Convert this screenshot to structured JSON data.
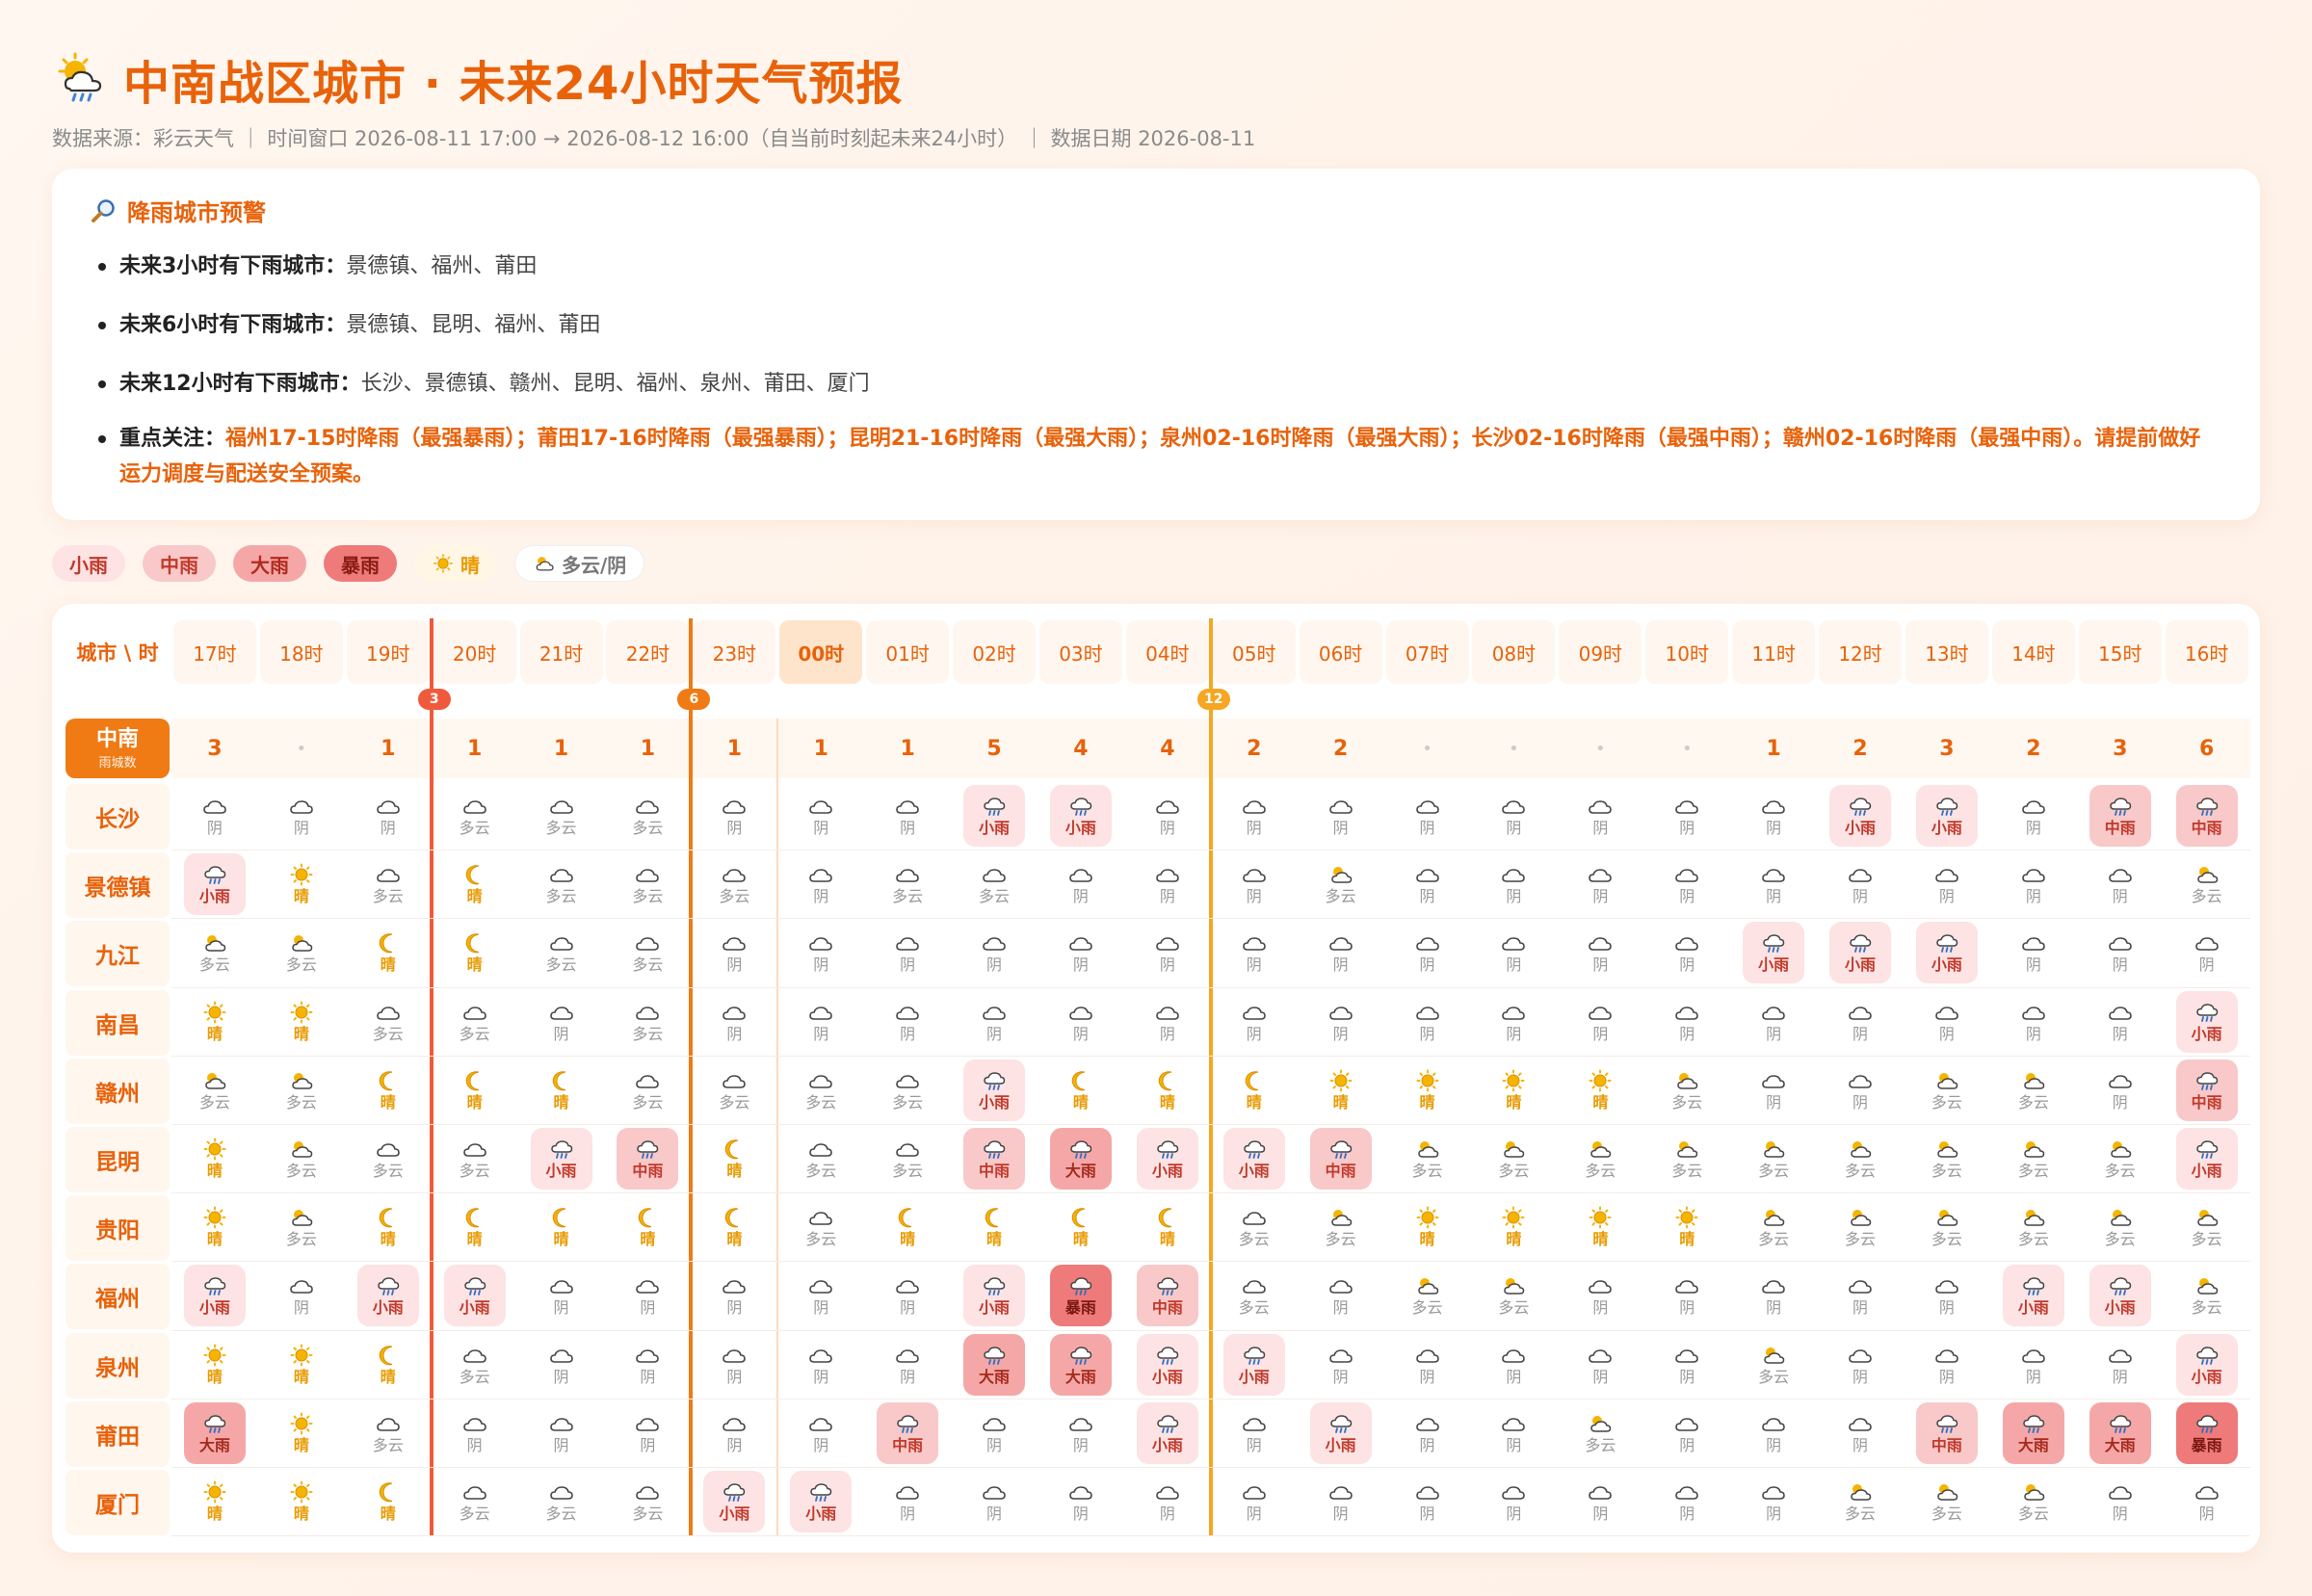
{
  "header": {
    "title": "中南战区城市 · 未来24小时天气预报",
    "subtitle": "数据来源：彩云天气 ｜ 时间窗口 2026-08-11 17:00 → 2026-08-12 16:00（自当前时刻起未来24小时） ｜ 数据日期 2026-08-11"
  },
  "alert": {
    "title": "降雨城市预警",
    "items": [
      {
        "label": "未来3小时有下雨城市：",
        "text": "景德镇、福州、莆田"
      },
      {
        "label": "未来6小时有下雨城市：",
        "text": "景德镇、昆明、福州、莆田"
      },
      {
        "label": "未来12小时有下雨城市：",
        "text": "长沙、景德镇、赣州、昆明、福州、泉州、莆田、厦门"
      }
    ],
    "focus": {
      "label": "重点关注：",
      "text": "福州17-15时降雨（最强暴雨）；莆田17-16时降雨（最强暴雨）；昆明21-16时降雨（最强大雨）；泉州02-16时降雨（最强大雨）；长沙02-16时降雨（最强中雨）；赣州02-16时降雨（最强中雨）。请提前做好运力调度与配送安全预案。"
    }
  },
  "legend": [
    {
      "label": "小雨",
      "kind": "light"
    },
    {
      "label": "中雨",
      "kind": "mod"
    },
    {
      "label": "大雨",
      "kind": "heavy"
    },
    {
      "label": "暴雨",
      "kind": "storm"
    },
    {
      "label": "晴",
      "kind": "sun"
    },
    {
      "label": "多云/阴",
      "kind": "cloud"
    }
  ],
  "grid": {
    "corner_label": "城市 \\ 时",
    "region": {
      "name": "中南",
      "sub": "雨城数"
    },
    "hours": [
      "17时",
      "18时",
      "19时",
      "20时",
      "21时",
      "22时",
      "23时",
      "00时",
      "01时",
      "02时",
      "03时",
      "04时",
      "05时",
      "06时",
      "07时",
      "08时",
      "09时",
      "10时",
      "11时",
      "12时",
      "13时",
      "14时",
      "15时",
      "16时"
    ],
    "current_hour_index": 7,
    "rain_counts": [
      "3",
      "•",
      "1",
      "1",
      "1",
      "1",
      "1",
      "1",
      "1",
      "5",
      "4",
      "4",
      "2",
      "2",
      "•",
      "•",
      "•",
      "•",
      "1",
      "2",
      "3",
      "2",
      "3",
      "6"
    ],
    "markers": [
      {
        "label": "3",
        "after_index": 2,
        "color": "#f05a3c"
      },
      {
        "label": "6",
        "after_index": 5,
        "color": "#f07a14"
      },
      {
        "label": "12",
        "after_index": 11,
        "color": "#f5a623"
      }
    ],
    "cities": [
      {
        "name": "长沙",
        "cells": [
          "阴",
          "阴",
          "阴",
          "多云",
          "多云",
          "多云",
          "阴",
          "阴",
          "阴",
          "小雨",
          "小雨",
          "阴",
          "阴",
          "阴",
          "阴",
          "阴",
          "阴",
          "阴",
          "阴",
          "小雨",
          "小雨",
          "阴",
          "中雨",
          "中雨"
        ]
      },
      {
        "name": "景德镇",
        "cells": [
          "小雨",
          "晴",
          "多云",
          "晴",
          "多云",
          "多云",
          "多云",
          "阴",
          "多云",
          "多云",
          "阴",
          "阴",
          "阴",
          "多云",
          "阴",
          "阴",
          "阴",
          "阴",
          "阴",
          "阴",
          "阴",
          "阴",
          "阴",
          "多云"
        ]
      },
      {
        "name": "九江",
        "cells": [
          "多云",
          "多云",
          "晴",
          "晴",
          "多云",
          "多云",
          "阴",
          "阴",
          "阴",
          "阴",
          "阴",
          "阴",
          "阴",
          "阴",
          "阴",
          "阴",
          "阴",
          "阴",
          "小雨",
          "小雨",
          "小雨",
          "阴",
          "阴",
          "阴"
        ]
      },
      {
        "name": "南昌",
        "cells": [
          "晴",
          "晴",
          "多云",
          "多云",
          "阴",
          "多云",
          "阴",
          "阴",
          "阴",
          "阴",
          "阴",
          "阴",
          "阴",
          "阴",
          "阴",
          "阴",
          "阴",
          "阴",
          "阴",
          "阴",
          "阴",
          "阴",
          "阴",
          "小雨"
        ]
      },
      {
        "name": "赣州",
        "cells": [
          "多云",
          "多云",
          "晴",
          "晴",
          "晴",
          "多云",
          "多云",
          "多云",
          "多云",
          "小雨",
          "晴",
          "晴",
          "晴",
          "晴",
          "晴",
          "晴",
          "晴",
          "多云",
          "阴",
          "阴",
          "多云",
          "多云",
          "阴",
          "中雨"
        ]
      },
      {
        "name": "昆明",
        "cells": [
          "晴",
          "多云",
          "多云",
          "多云",
          "小雨",
          "中雨",
          "晴",
          "多云",
          "多云",
          "中雨",
          "大雨",
          "小雨",
          "小雨",
          "中雨",
          "多云",
          "多云",
          "多云",
          "多云",
          "多云",
          "多云",
          "多云",
          "多云",
          "多云",
          "小雨"
        ]
      },
      {
        "name": "贵阳",
        "cells": [
          "晴",
          "多云",
          "晴",
          "晴",
          "晴",
          "晴",
          "晴",
          "多云",
          "晴",
          "晴",
          "晴",
          "晴",
          "多云",
          "多云",
          "晴",
          "晴",
          "晴",
          "晴",
          "多云",
          "多云",
          "多云",
          "多云",
          "多云",
          "多云"
        ]
      },
      {
        "name": "福州",
        "cells": [
          "小雨",
          "阴",
          "小雨",
          "小雨",
          "阴",
          "阴",
          "阴",
          "阴",
          "阴",
          "小雨",
          "暴雨",
          "中雨",
          "多云",
          "阴",
          "多云",
          "多云",
          "阴",
          "阴",
          "阴",
          "阴",
          "阴",
          "小雨",
          "小雨",
          "多云"
        ]
      },
      {
        "name": "泉州",
        "cells": [
          "晴",
          "晴",
          "晴",
          "多云",
          "阴",
          "阴",
          "阴",
          "阴",
          "阴",
          "大雨",
          "大雨",
          "小雨",
          "小雨",
          "阴",
          "阴",
          "阴",
          "阴",
          "阴",
          "多云",
          "阴",
          "阴",
          "阴",
          "阴",
          "小雨"
        ]
      },
      {
        "name": "莆田",
        "cells": [
          "大雨",
          "晴",
          "多云",
          "阴",
          "阴",
          "阴",
          "阴",
          "阴",
          "中雨",
          "阴",
          "阴",
          "小雨",
          "阴",
          "小雨",
          "阴",
          "阴",
          "多云",
          "阴",
          "阴",
          "阴",
          "中雨",
          "大雨",
          "大雨",
          "暴雨"
        ]
      },
      {
        "name": "厦门",
        "cells": [
          "晴",
          "晴",
          "晴",
          "多云",
          "多云",
          "多云",
          "小雨",
          "小雨",
          "阴",
          "阴",
          "阴",
          "阴",
          "阴",
          "阴",
          "阴",
          "阴",
          "阴",
          "阴",
          "阴",
          "多云",
          "多云",
          "多云",
          "阴",
          "阴"
        ]
      }
    ],
    "night_hour_indices": [
      2,
      3,
      4,
      5,
      6,
      7,
      8,
      9,
      10,
      11,
      12
    ]
  },
  "colors": {
    "accent": "#e8620a",
    "light_rain": "#fde3e3",
    "moderate_rain": "#f9c8c8",
    "heavy_rain": "#f5a7a7",
    "storm": "#ee7a7a",
    "sun": "#f5b400"
  },
  "icons": {
    "title": "sun-cloud-rain-icon",
    "alert": "magnifier-icon",
    "weather": [
      "cloud-icon",
      "sun-icon",
      "moon-icon",
      "partly-cloudy-icon",
      "rain-cloud-icon"
    ]
  }
}
